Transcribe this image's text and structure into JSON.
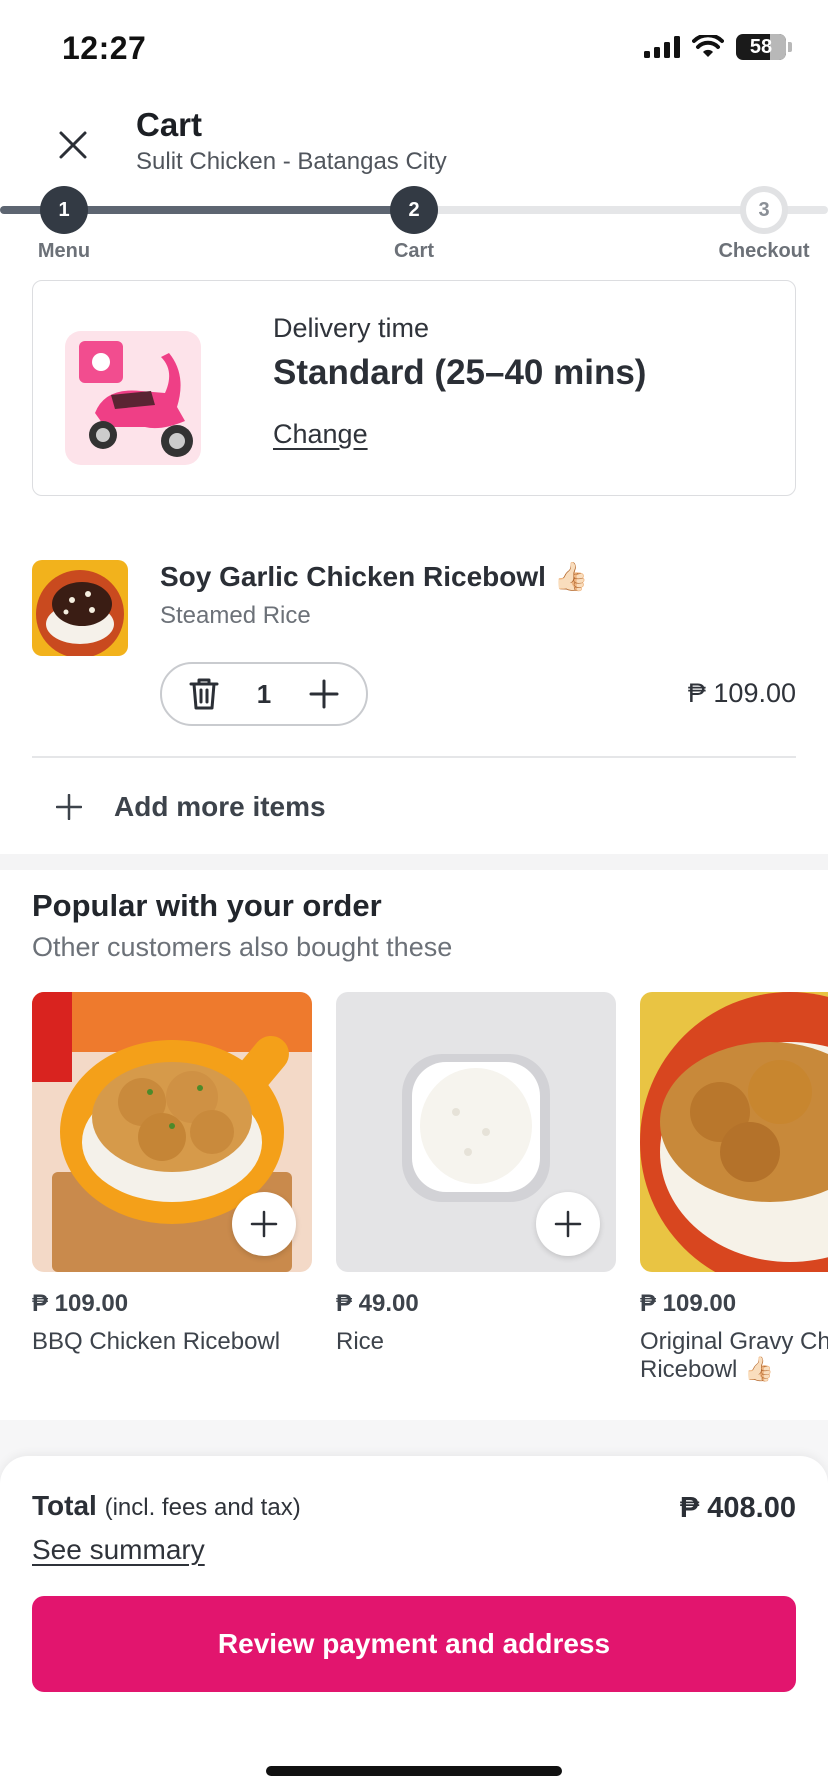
{
  "status_bar": {
    "time": "12:27",
    "battery": "58"
  },
  "header": {
    "title": "Cart",
    "subtitle": "Sulit Chicken - Batangas City"
  },
  "stepper": {
    "steps": [
      {
        "number": "1",
        "label": "Menu"
      },
      {
        "number": "2",
        "label": "Cart"
      },
      {
        "number": "3",
        "label": "Checkout"
      }
    ]
  },
  "delivery": {
    "label": "Delivery time",
    "value": "Standard (25–40 mins)",
    "change": "Change"
  },
  "cart_item": {
    "name": "Soy Garlic Chicken Ricebowl 👍🏻",
    "option": "Steamed Rice",
    "quantity": "1",
    "price": "₱ 109.00"
  },
  "add_more": {
    "label": "Add more items"
  },
  "popular": {
    "title": "Popular with your order",
    "subtitle": "Other customers also bought these",
    "items": [
      {
        "price": "₱ 109.00",
        "name": "BBQ Chicken Ricebowl"
      },
      {
        "price": "₱ 49.00",
        "name": "Rice"
      },
      {
        "price": "₱ 109.00",
        "name": "Original Gravy Chicken Ricebowl 👍🏻"
      }
    ]
  },
  "summary": {
    "total_label": "Total",
    "total_note": "(incl. fees and tax)",
    "see_summary": "See summary",
    "total_value": "₱ 408.00",
    "review_button": "Review payment and address"
  },
  "colors": {
    "accent": "#e2156e",
    "dark": "#333a44"
  }
}
